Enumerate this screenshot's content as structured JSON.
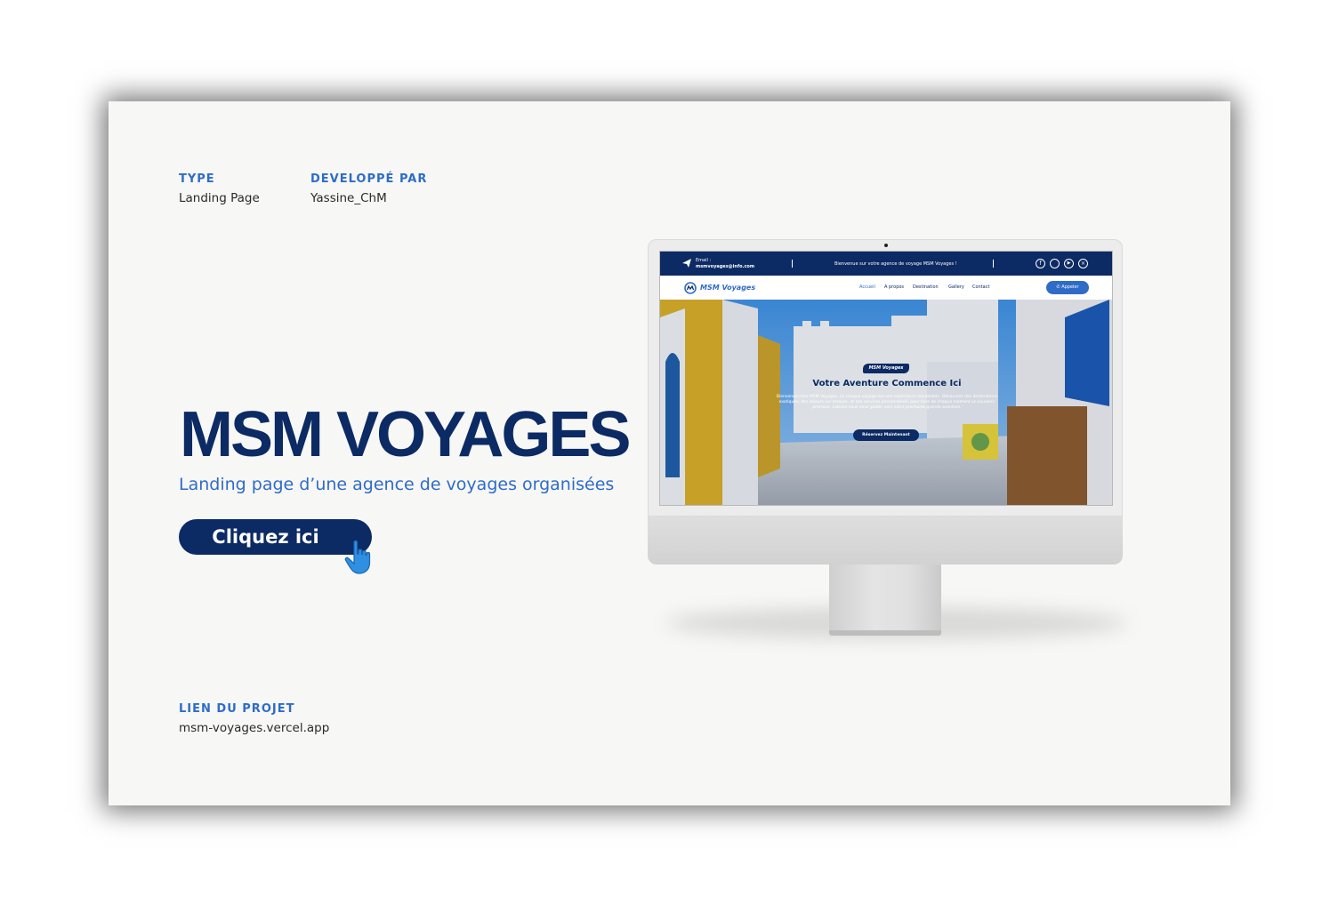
{
  "meta": {
    "type_label": "TYPE",
    "type_value": "Landing Page",
    "dev_label": "DEVELOPPÉ PAR",
    "dev_value": "Yassine_ChM",
    "link_label": "LIEN DU PROJET",
    "link_value": "msm-voyages.vercel.app"
  },
  "hero": {
    "title": "MSM VOYAGES",
    "subtitle": "Landing page d’une agence de voyages organisées",
    "cta_label": "Cliquez ici"
  },
  "screen": {
    "topbar": {
      "email_label": "Email :",
      "email_value": "msmvoyages@info.com",
      "welcome": "Bienvenue sur votre agence de voyage MSM Voyages !"
    },
    "navbar": {
      "logo_text": "MSM Voyages",
      "links": [
        "Accueil",
        "A propos",
        "Destination",
        "Gallery",
        "Contact"
      ],
      "call_button": "Appeler"
    },
    "hero": {
      "badge": "MSM Voyages",
      "title": "Votre Aventure Commence Ici",
      "text": "Bienvenue chez MSM Voyages, où chaque voyage est une expérience inoubliable. Découvrez des destinations exotiques, des séjours sur mesure, et des services personnalisés pour faire de chaque moment un souvenir précieux. Laissez-nous vous guider vers votre prochaine grande aventure.",
      "button": "Réservez Maintenant"
    }
  },
  "colors": {
    "navy": "#0c2a63",
    "accent_blue": "#2e6cc8",
    "card_bg": "#f7f7f5"
  }
}
